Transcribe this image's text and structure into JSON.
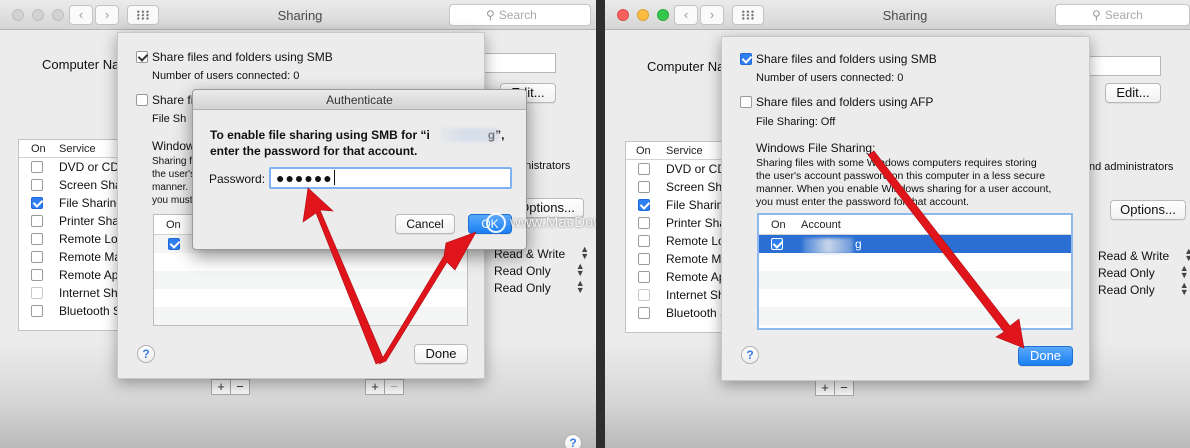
{
  "colors": {
    "close": "#fc605c",
    "minimize": "#fdbc40",
    "zoom": "#34c84a",
    "accent": "#2f7ff0",
    "arrow": "#e0151b"
  },
  "window": {
    "title": "Sharing",
    "search_placeholder": "Search",
    "back": "‹",
    "forward": "›"
  },
  "main": {
    "computer_name_label": "Computer Name:",
    "edit_label": "Edit...",
    "options_label": "Options...",
    "col_on": "On",
    "col_service": "Service",
    "admin_text": "nd administrators",
    "services_left": [
      "DVD or CD",
      "Screen Sha",
      "File Sharing",
      "Printer Sha",
      "Remote Lo",
      "Remote Ma",
      "Remote Ap",
      "Internet Sh",
      "Bluetooth S"
    ],
    "services_right": [
      "DVD or CD",
      "Screen Sha",
      "File Sharing",
      "Printer Sha",
      "Remote Log",
      "Remote Ma",
      "Remote Ap",
      "Internet Sh",
      "Bluetooth S"
    ],
    "permissions": [
      "Read & Write",
      "Read Only",
      "Read Only"
    ],
    "plus": "+",
    "minus": "−",
    "help": "?"
  },
  "sheet": {
    "smb_label": "Share files and folders using SMB",
    "smb_users": "Number of users connected: 0",
    "afp_label": "Share files and folders using AFP",
    "afp_label_partial": "Share fi",
    "afp_status": "File Sharing: Off",
    "afp_status_partial": "File Sh",
    "windows_heading": "Windows File Sharing:",
    "windows_heading_partial": "Windows",
    "windows_desc": [
      "Sharing files with some Windows computers requires storing",
      "the user's account password on this computer in a less secure",
      "manner.  When you enable Windows sharing for a user account,",
      "you must enter the password for that account."
    ],
    "windows_desc_partial": [
      "Sharing f",
      "the user's",
      "manner.",
      "you must"
    ],
    "col_on": "On",
    "col_account": "Account",
    "account_name": "g",
    "done_label": "Done"
  },
  "auth": {
    "title": "Authenticate",
    "message_line1_start": "To enable file sharing using SMB for “i",
    "message_line1_end": "g”,",
    "message_line2": "enter the password for that account.",
    "password_label": "Password:",
    "password_value": "●●●●●●",
    "cancel_label": "Cancel",
    "ok_label": "OK"
  },
  "watermark": "www.MacDown.com"
}
